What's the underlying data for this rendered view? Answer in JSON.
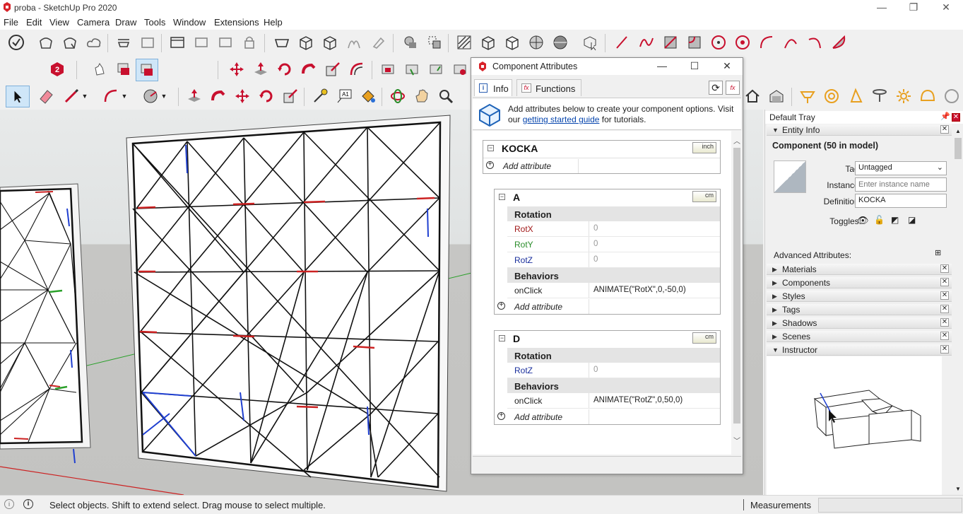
{
  "app": {
    "title": "proba - SketchUp Pro 2020",
    "window_controls": {
      "minimize": "—",
      "maximize": "❐",
      "close": "✕"
    }
  },
  "menu": [
    "File",
    "Edit",
    "View",
    "Camera",
    "Draw",
    "Tools",
    "Window",
    "Extensions",
    "Help"
  ],
  "dialog": {
    "title": "Component Attributes",
    "controls": {
      "minimize": "—",
      "maximize": "☐",
      "close": "✕"
    },
    "tabs": [
      {
        "label": "Info",
        "active": true
      },
      {
        "label": "Functions",
        "active": false
      }
    ],
    "info": {
      "text_before": "Add attributes below to create your component options. Visit our ",
      "link": "getting started guide",
      "text_after": " for tutorials."
    },
    "components": [
      {
        "name": "KOCKA",
        "unit": "inch",
        "add_label": "Add attribute"
      },
      {
        "name": "A",
        "unit": "cm",
        "groups": [
          {
            "title": "Rotation",
            "rows": [
              {
                "name": "RotX",
                "value": "0",
                "color": "#a11818"
              },
              {
                "name": "RotY",
                "value": "0",
                "color": "#2a8c2a"
              },
              {
                "name": "RotZ",
                "value": "0",
                "color": "#1a2f9c"
              }
            ]
          },
          {
            "title": "Behaviors",
            "rows": [
              {
                "name": "onClick",
                "value": "ANIMATE(\"RotX\",0,-50,0)",
                "color": "#222222"
              }
            ]
          }
        ],
        "add_label": "Add attribute"
      },
      {
        "name": "D",
        "unit": "cm",
        "groups": [
          {
            "title": "Rotation",
            "rows": [
              {
                "name": "RotZ",
                "value": "0",
                "color": "#1a2f9c"
              }
            ]
          },
          {
            "title": "Behaviors",
            "rows": [
              {
                "name": "onClick",
                "value": "ANIMATE(\"RotZ\",0,50,0)",
                "color": "#222222"
              }
            ]
          }
        ],
        "add_label": "Add attribute"
      }
    ]
  },
  "tray": {
    "title": "Default Tray",
    "entity_info": {
      "section": "Entity Info",
      "heading": "Component (50 in model)",
      "tag_label": "Tag:",
      "tag_value": "Untagged",
      "instance_label": "Instance:",
      "instance_placeholder": "Enter instance name",
      "definition_label": "Definition:",
      "definition_value": "KOCKA",
      "toggles_label": "Toggles:",
      "advanced_label": "Advanced Attributes:"
    },
    "sections": [
      "Materials",
      "Components",
      "Styles",
      "Tags",
      "Shadows",
      "Scenes",
      "Instructor"
    ]
  },
  "status": {
    "text": "Select objects. Shift to extend select. Drag mouse to select multiple.",
    "measurements_label": "Measurements"
  },
  "colors": {
    "accent_red": "#c8102e",
    "axis_red": "#cc2222",
    "axis_green": "#2aa02a",
    "axis_blue": "#1f3fd0",
    "link": "#0645ad"
  }
}
